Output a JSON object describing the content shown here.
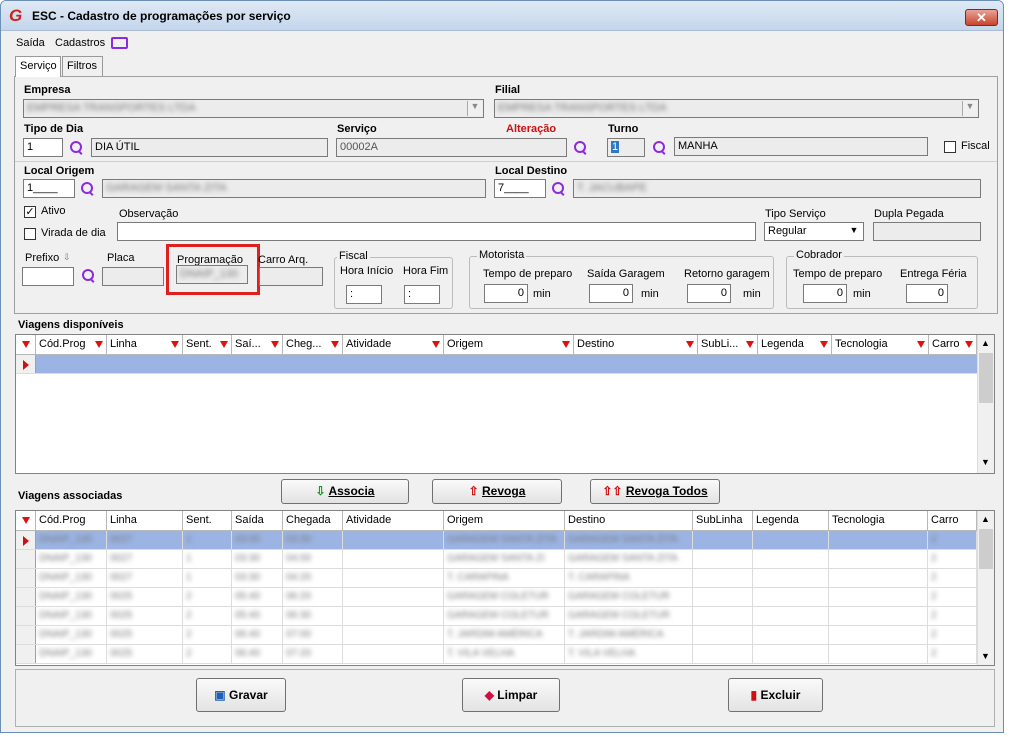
{
  "window": {
    "title": "ESC - Cadastro de programações por serviço",
    "logo": "G",
    "close": "✕"
  },
  "menu": {
    "saida": "Saída",
    "cadastros": "Cadastros"
  },
  "tabs": [
    "Serviço",
    "Filtros"
  ],
  "empresa": {
    "label": "Empresa",
    "value": "EMPRESA TRANSPORTES LTDA"
  },
  "filial": {
    "label": "Filial",
    "value": "EMPRESA TRANSPORTES LTDA"
  },
  "tipo_dia": {
    "label": "Tipo de Dia",
    "code": "1",
    "desc": "DIA ÚTIL"
  },
  "servico": {
    "label": "Serviço",
    "value": "00002A",
    "alteracao": "Alteração"
  },
  "turno": {
    "label": "Turno",
    "code": "1",
    "desc": "MANHA",
    "fiscal": "Fiscal"
  },
  "local_origem": {
    "label": "Local Origem",
    "code": "1____",
    "desc": "GARAGEM SANTA ZITA"
  },
  "local_destino": {
    "label": "Local Destino",
    "code": "7____",
    "desc": "T. JACUBAPE"
  },
  "ativo": {
    "label": "Ativo",
    "checked": true
  },
  "virada": {
    "label": "Virada de dia",
    "checked": false
  },
  "observacao": {
    "label": "Observação",
    "value": ""
  },
  "tipo_servico": {
    "label": "Tipo Serviço",
    "value": "Regular"
  },
  "dupla_pegada": {
    "label": "Dupla Pegada",
    "value": ""
  },
  "prefixo": {
    "label": "Prefixo",
    "value": ""
  },
  "placa": {
    "label": "Placa",
    "value": ""
  },
  "programacao": {
    "label": "Programação",
    "value": "DNAIP_130"
  },
  "carro_arq": {
    "label": "Carro Arq.",
    "value": ""
  },
  "fiscal_grp": {
    "title": "Fiscal",
    "hora_inicio": "Hora Início",
    "hora_fim": "Hora Fim",
    "inicio_val": ":",
    "fim_val": ":"
  },
  "motorista": {
    "title": "Motorista",
    "tempo_preparo": "Tempo de preparo",
    "saida_garagem": "Saída Garagem",
    "retorno_garagem": "Retorno garagem",
    "v1": "0",
    "v2": "0",
    "v3": "0",
    "unit": "min"
  },
  "cobrador": {
    "title": "Cobrador",
    "tempo_preparo": "Tempo de preparo",
    "entrega_feria": "Entrega Féria",
    "v1": "0",
    "v2": "0",
    "unit": "min"
  },
  "viagens_disp": {
    "title": "Viagens disponíveis",
    "columns": [
      "Cód.Prog",
      "Linha",
      "Sent.",
      "Saí...",
      "Cheg...",
      "Atividade",
      "Origem",
      "Destino",
      "SubLi...",
      "Legenda",
      "Tecnologia",
      "Carro"
    ]
  },
  "buttons": {
    "associa": "Associa",
    "revoga": "Revoga",
    "revoga_todos": "Revoga Todos",
    "gravar": "Gravar",
    "limpar": "Limpar",
    "excluir": "Excluir"
  },
  "viagens_assoc": {
    "title": "Viagens associadas",
    "columns": [
      "Cód.Prog",
      "Linha",
      "Sent.",
      "Saída",
      "Chegada",
      "Atividade",
      "Origem",
      "Destino",
      "SubLinha",
      "Legenda",
      "Tecnologia",
      "Carro"
    ],
    "rows": [
      [
        "DNAIP_130",
        "0027",
        "1",
        "03:00",
        "03:30",
        "",
        "GARAGEM SANTA ZITA",
        "GARAGEM SANTA ZITA",
        "",
        "",
        "",
        "2"
      ],
      [
        "DNAIP_130",
        "0027",
        "1",
        "03:30",
        "04:00",
        "",
        "GARAGEM SANTA ZI",
        "GARAGEM SANTA ZITA",
        "",
        "",
        "",
        "2"
      ],
      [
        "DNAIP_130",
        "0027",
        "1",
        "03:30",
        "04:20",
        "",
        "T. CARAPINA",
        "T. CARAPINA",
        "",
        "",
        "",
        "2"
      ],
      [
        "DNAIP_130",
        "0025",
        "2",
        "05:40",
        "06:20",
        "",
        "GARAGEM COLETUR",
        "GARAGEM COLETUR",
        "",
        "",
        "",
        "2"
      ],
      [
        "DNAIP_130",
        "0025",
        "2",
        "05:40",
        "06:30",
        "",
        "GARAGEM COLETUR",
        "GARAGEM COLETUR",
        "",
        "",
        "",
        "2"
      ],
      [
        "DNAIP_130",
        "0025",
        "2",
        "06:40",
        "07:00",
        "",
        "T. JARDIM AMÉRICA",
        "T. JARDIM AMÉRICA",
        "",
        "",
        "",
        "2"
      ],
      [
        "DNAIP_130",
        "0025",
        "2",
        "06:40",
        "07:20",
        "",
        "T. VILA VELHA",
        "T. VILA VELHA",
        "",
        "",
        "",
        "2"
      ]
    ]
  }
}
